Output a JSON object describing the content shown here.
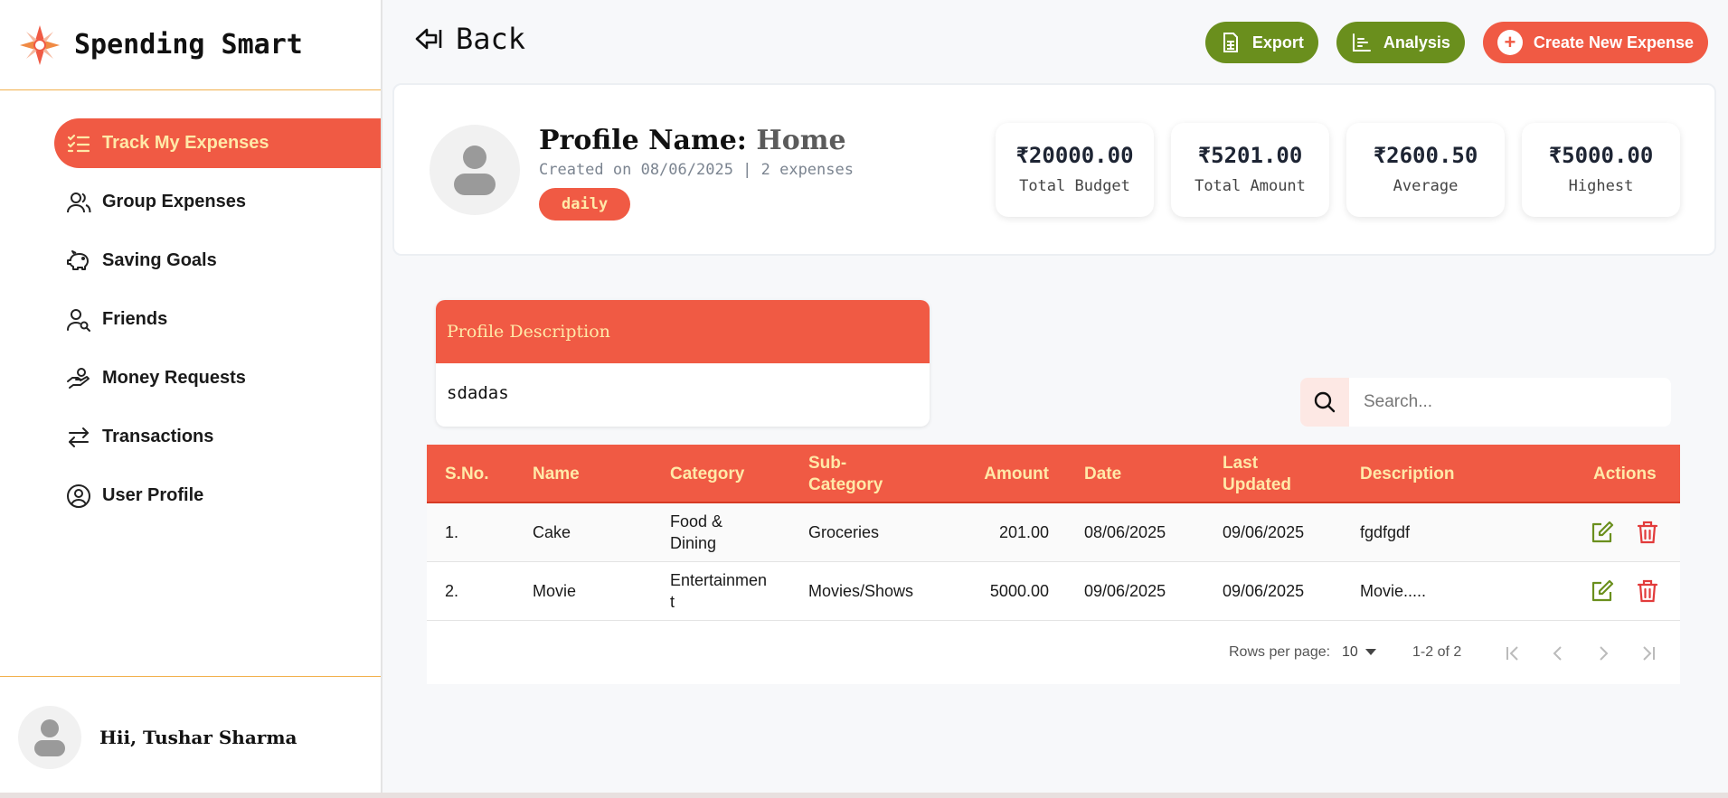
{
  "brand": {
    "title": "Spending Smart"
  },
  "sidebar": {
    "items": [
      {
        "label": "Track My Expenses",
        "icon": "checklist-icon",
        "active": true
      },
      {
        "label": "Group Expenses",
        "icon": "users-icon",
        "active": false
      },
      {
        "label": "Saving Goals",
        "icon": "piggy-bank-icon",
        "active": false
      },
      {
        "label": "Friends",
        "icon": "user-search-icon",
        "active": false
      },
      {
        "label": "Money Requests",
        "icon": "hand-coin-icon",
        "active": false
      },
      {
        "label": "Transactions",
        "icon": "arrows-left-right-icon",
        "active": false
      },
      {
        "label": "User Profile",
        "icon": "user-circle-icon",
        "active": false
      }
    ],
    "greeting": "Hii, Tushar Sharma"
  },
  "topbar": {
    "back_label": "Back",
    "export_label": "Export",
    "analysis_label": "Analysis",
    "create_label": "Create New Expense"
  },
  "profile": {
    "name_label": "Profile Name:",
    "name_value": "Home",
    "meta": "Created on 08/06/2025 | 2 expenses",
    "tag": "daily"
  },
  "stats": [
    {
      "value": "₹20000.00",
      "label": "Total Budget"
    },
    {
      "value": "₹5201.00",
      "label": "Total Amount"
    },
    {
      "value": "₹2600.50",
      "label": "Average"
    },
    {
      "value": "₹5000.00",
      "label": "Highest"
    }
  ],
  "description": {
    "title": "Profile Description",
    "text": "sdadas"
  },
  "search": {
    "placeholder": "Search..."
  },
  "table": {
    "headers": {
      "sno": "S.No.",
      "name": "Name",
      "category": "Category",
      "subcategory": "Sub-Category",
      "amount": "Amount",
      "date": "Date",
      "updated": "Last Updated",
      "description": "Description",
      "actions": "Actions"
    },
    "rows": [
      {
        "sno": "1.",
        "name": "Cake",
        "category": "Food & Dining",
        "subcategory": "Groceries",
        "amount": "201.00",
        "date": "08/06/2025",
        "updated": "09/06/2025",
        "description": "fgdfgdf"
      },
      {
        "sno": "2.",
        "name": "Movie",
        "category": "Entertainment",
        "subcategory": "Movies/Shows",
        "amount": "5000.00",
        "date": "09/06/2025",
        "updated": "09/06/2025",
        "description": "Movie....."
      }
    ]
  },
  "pagination": {
    "rows_per_page_label": "Rows per page:",
    "rows_per_page": "10",
    "range": "1-2 of 2"
  },
  "colors": {
    "accent": "#f05a44",
    "green": "#6a8f1d",
    "header_text": "#ffe9a8",
    "edit": "#6a8f1d",
    "delete": "#e23b3b"
  }
}
